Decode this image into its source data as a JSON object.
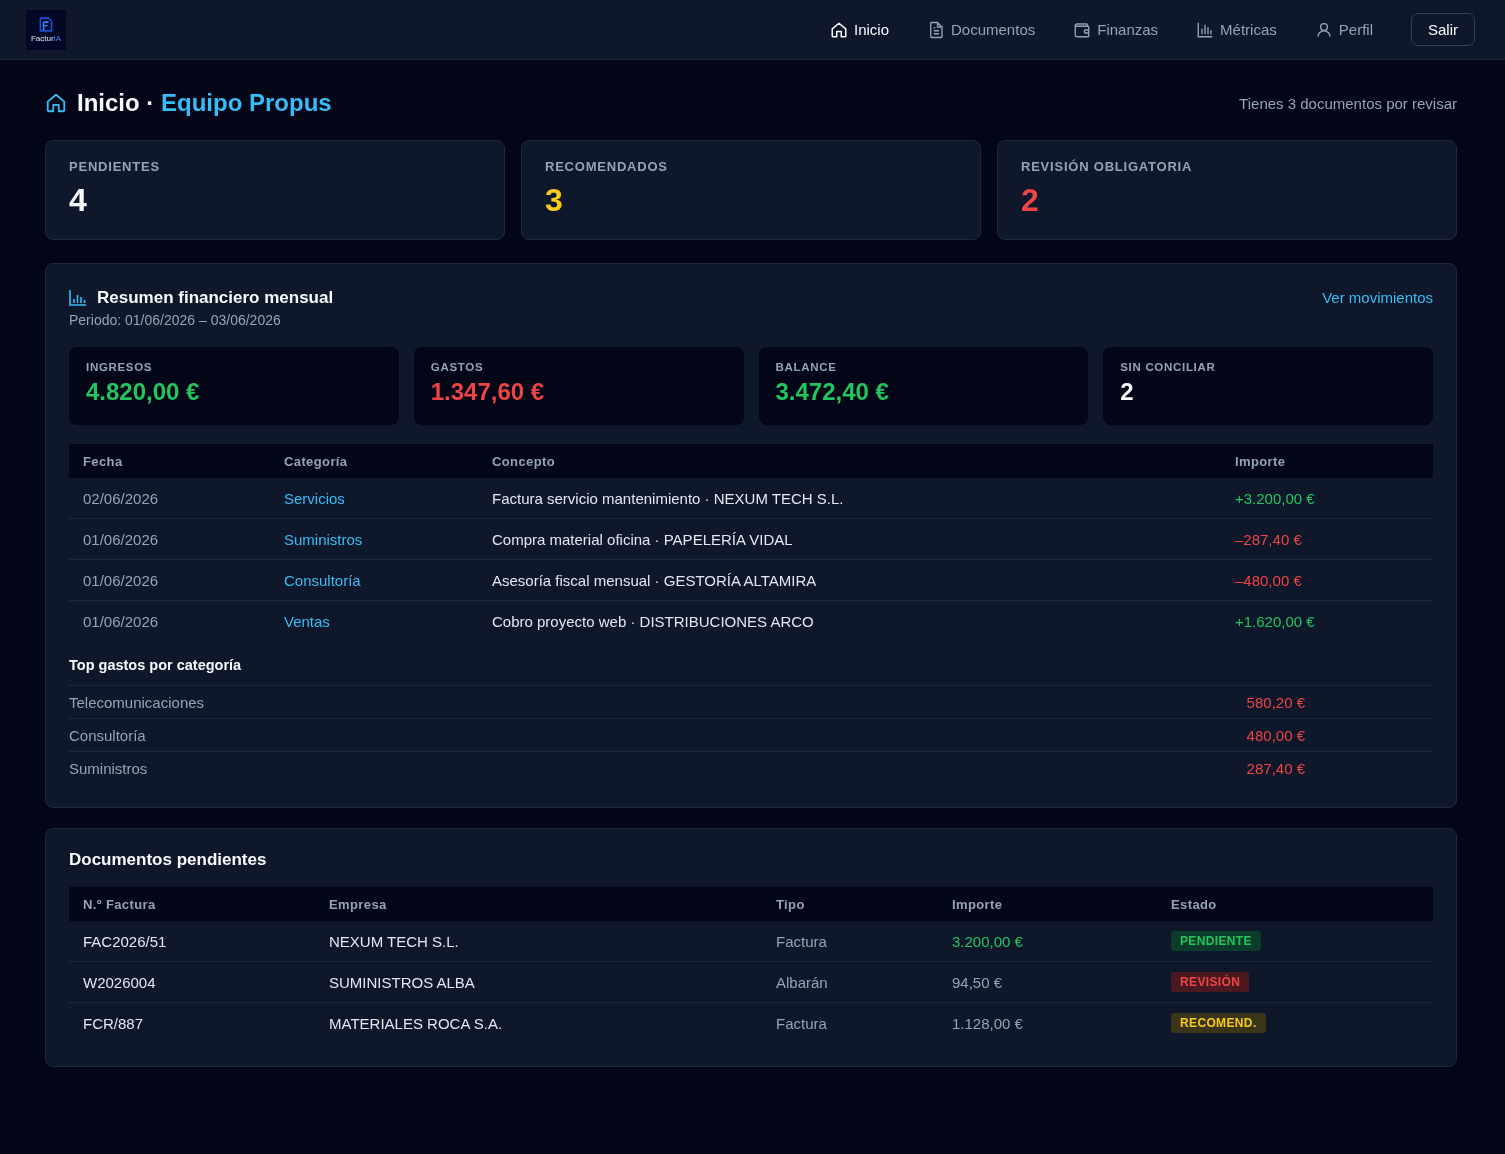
{
  "nav": {
    "logo": {
      "text": "Factur",
      "accent": "IA"
    },
    "items": [
      {
        "label": "Inicio",
        "kind": "home",
        "selected": true
      },
      {
        "label": "Documentos",
        "kind": "document",
        "selected": false
      },
      {
        "label": "Finanzas",
        "kind": "wallet",
        "selected": false
      },
      {
        "label": "Métricas",
        "kind": "chart",
        "selected": false
      },
      {
        "label": "Perfil",
        "kind": "user",
        "selected": false
      }
    ],
    "logout": "Salir"
  },
  "header": {
    "title": "Inicio ·",
    "team": "Equipo Propus",
    "notice": "Tienes 3 documentos por revisar"
  },
  "stats": [
    {
      "label": "PENDIENTES",
      "value": "4",
      "color": "#f8fafc"
    },
    {
      "label": "RECOMENDADOS",
      "value": "3",
      "color": "#facc15"
    },
    {
      "label": "REVISIÓN OBLIGATORIA",
      "value": "2",
      "color": "#ef4444"
    }
  ],
  "finance": {
    "title": "Resumen financiero mensual",
    "period": "Periodo: 01/06/2026 – 03/06/2026",
    "link": "Ver movimientos",
    "metrics": [
      {
        "label": "INGRESOS",
        "value": "4.820,00 €",
        "color": "#22c55e"
      },
      {
        "label": "GASTOS",
        "value": "1.347,60 €",
        "color": "#ef4444"
      },
      {
        "label": "BALANCE",
        "value": "3.472,40 €",
        "color": "#22c55e"
      },
      {
        "label": "SIN CONCILIAR",
        "value": "2",
        "color": "#f8fafc"
      }
    ],
    "table": {
      "columns": [
        "Fecha",
        "Categoría",
        "Concepto",
        "Importe"
      ],
      "rows": [
        {
          "date": "02/06/2026",
          "category": "Servicios",
          "concept": "Factura servicio mantenimiento · NEXUM TECH S.L.",
          "amount": "+3.200,00 €",
          "kind": "income"
        },
        {
          "date": "01/06/2026",
          "category": "Suministros",
          "concept": "Compra material oficina · PAPELERÍA VIDAL",
          "amount": "–287,40 €",
          "kind": "expense"
        },
        {
          "date": "01/06/2026",
          "category": "Consultoría",
          "concept": "Asesoría fiscal mensual · GESTORÍA ALTAMIRA",
          "amount": "–480,00 €",
          "kind": "expense"
        },
        {
          "date": "01/06/2026",
          "category": "Ventas",
          "concept": "Cobro proyecto web · DISTRIBUCIONES ARCO",
          "amount": "+1.620,00 €",
          "kind": "income"
        }
      ]
    },
    "top_expenses": {
      "title": "Top gastos por categoría",
      "rows": [
        {
          "name": "Telecomunicaciones",
          "amount": "580,20 €"
        },
        {
          "name": "Consultoría",
          "amount": "480,00 €"
        },
        {
          "name": "Suministros",
          "amount": "287,40 €"
        }
      ]
    }
  },
  "documents": {
    "title": "Documentos pendientes",
    "columns": [
      "N.º Factura",
      "Empresa",
      "Tipo",
      "Importe",
      "Estado"
    ],
    "rows": [
      {
        "number": "FAC2026/51",
        "company": "NEXUM TECH S.L.",
        "type": "Factura",
        "amount": "3.200,00 €",
        "highlighted": true,
        "status": "PENDIENTE",
        "kind": "pending"
      },
      {
        "number": "W2026004",
        "company": "SUMINISTROS ALBA",
        "type": "Albarán",
        "amount": "94,50 €",
        "highlighted": false,
        "status": "REVISIÓN",
        "kind": "review"
      },
      {
        "number": "FCR/887",
        "company": "MATERIALES ROCA S.A.",
        "type": "Factura",
        "amount": "1.128,00 €",
        "highlighted": false,
        "status": "RECOMEND.",
        "kind": "recommended"
      }
    ]
  }
}
